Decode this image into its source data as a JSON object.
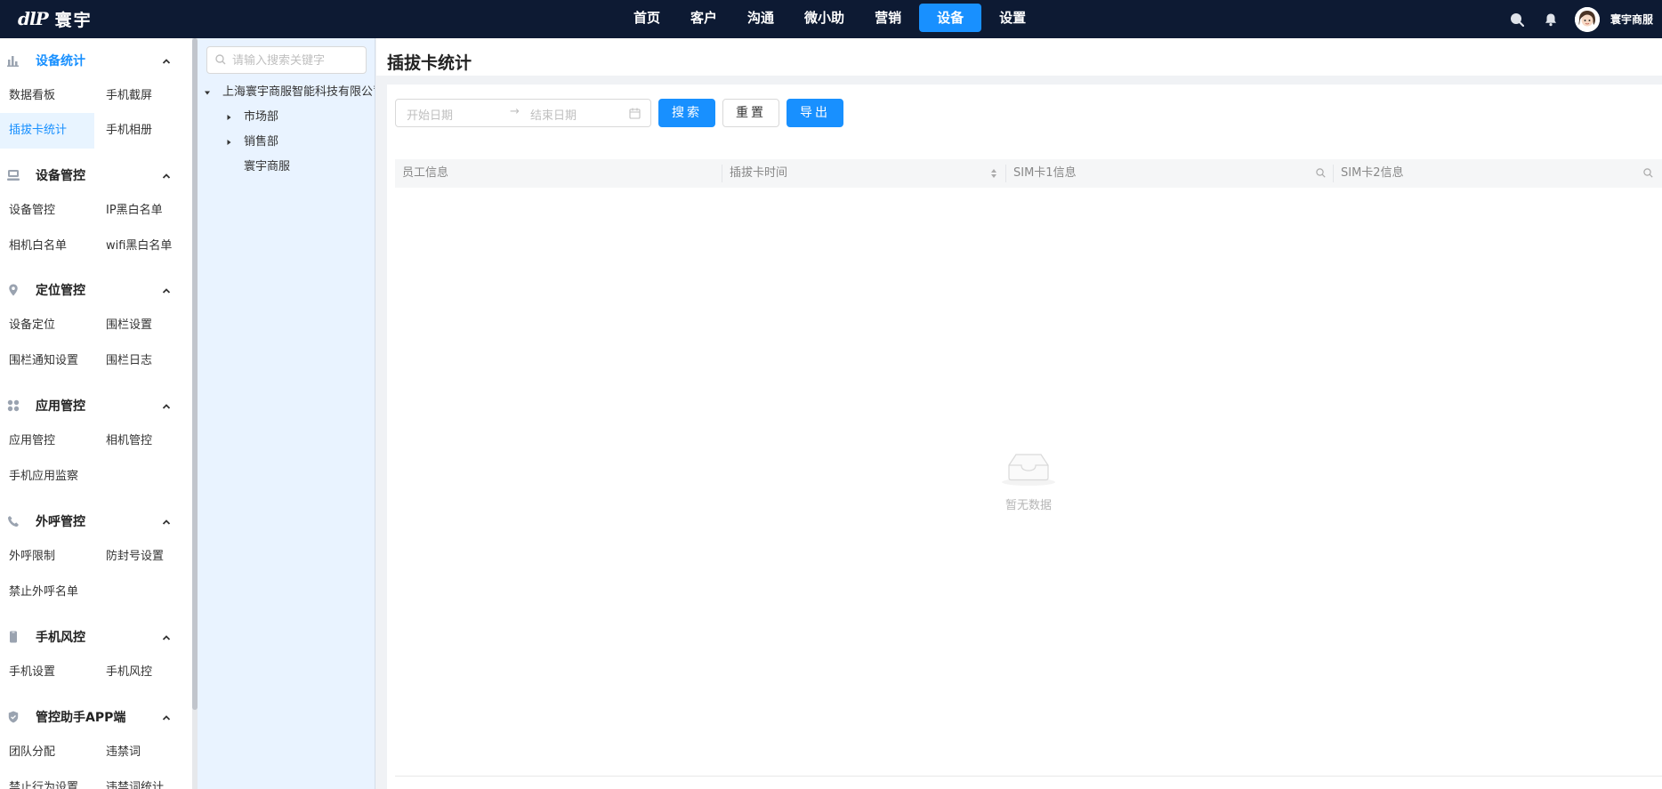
{
  "app": {
    "logo_mark": "dlP",
    "brand_name": "寰宇"
  },
  "nav": {
    "items": [
      {
        "label": "首页",
        "active": false
      },
      {
        "label": "客户",
        "active": false
      },
      {
        "label": "沟通",
        "active": false
      },
      {
        "label": "微小助",
        "active": false
      },
      {
        "label": "营销",
        "active": false
      },
      {
        "label": "设备",
        "active": true
      },
      {
        "label": "设置",
        "active": false
      }
    ],
    "icons": [
      "search-icon",
      "bell-icon"
    ],
    "user": {
      "name": "寰宇商服",
      "avatar": "avatar"
    }
  },
  "sidebar": {
    "groups": [
      {
        "title": "设备统计",
        "icon": "bar-chart-icon",
        "expanded": true,
        "items": [
          "数据看板",
          "手机截屏",
          "插拔卡统计",
          "手机相册"
        ],
        "active_item": "插拔卡统计"
      },
      {
        "title": "设备管控",
        "icon": "device-icon",
        "expanded": true,
        "items": [
          "设备管控",
          "IP黑白名单",
          "相机白名单",
          "wifi黑白名单"
        ]
      },
      {
        "title": "定位管控",
        "icon": "location-pin-icon",
        "expanded": true,
        "items": [
          "设备定位",
          "围栏设置",
          "围栏通知设置",
          "围栏日志"
        ]
      },
      {
        "title": "应用管控",
        "icon": "apps-grid-icon",
        "expanded": true,
        "items": [
          "应用管控",
          "相机管控",
          "手机应用监察"
        ]
      },
      {
        "title": "外呼管控",
        "icon": "phone-icon",
        "expanded": true,
        "items": [
          "外呼限制",
          "防封号设置",
          "禁止外呼名单"
        ]
      },
      {
        "title": "手机风控",
        "icon": "mobile-icon",
        "expanded": true,
        "items": [
          "手机设置",
          "手机风控"
        ]
      },
      {
        "title": "管控助手APP端",
        "icon": "shield-icon",
        "expanded": true,
        "items": [
          "团队分配",
          "违禁词",
          "禁止行为设置",
          "违禁词统计"
        ]
      }
    ]
  },
  "org_tree": {
    "search_placeholder": "请输入搜索关键字",
    "root": "上海寰宇商服智能科技有限公司",
    "children": [
      {
        "label": "市场部",
        "has_children": true
      },
      {
        "label": "销售部",
        "has_children": true
      },
      {
        "label": "寰宇商服",
        "has_children": false
      }
    ]
  },
  "main": {
    "title": "插拔卡统计",
    "filter": {
      "start_placeholder": "开始日期",
      "separator": "→",
      "end_placeholder": "结束日期",
      "search_button": "搜索",
      "reset_button": "重置",
      "export_button": "导出"
    },
    "table": {
      "columns": [
        "员工信息",
        "插拔卡时间",
        "SIM卡1信息",
        "SIM卡2信息"
      ],
      "rows": [],
      "empty_text": "暂无数据"
    }
  },
  "colors": {
    "nav_bg": "#0d1a33",
    "primary": "#1890ff",
    "tree_bg": "#e9f3ff",
    "active_item_bg": "#e8f4ff"
  }
}
